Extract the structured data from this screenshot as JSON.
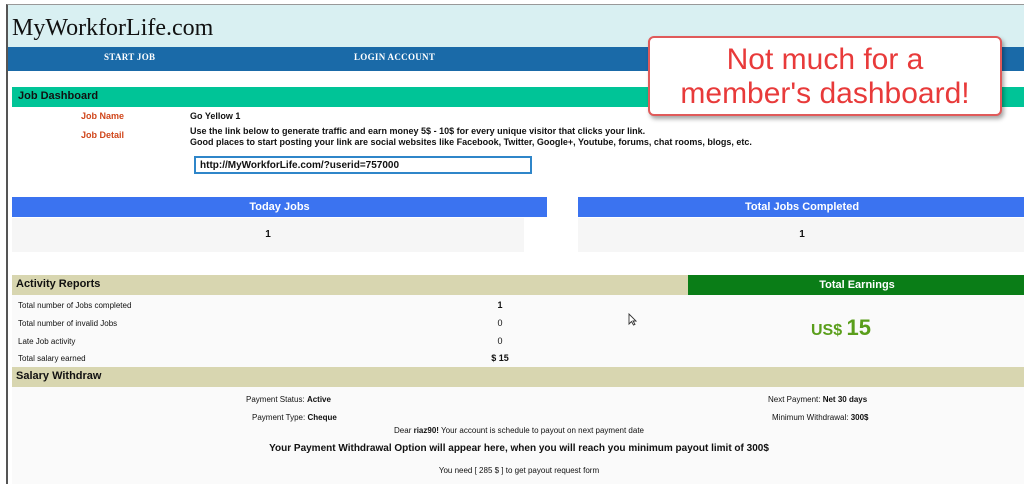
{
  "site": {
    "title": "MyWorkforLife.com"
  },
  "nav": {
    "items": [
      {
        "label": "START JOB"
      },
      {
        "label": "LOGIN ACCOUNT"
      }
    ]
  },
  "dashboard": {
    "heading": "Job Dashboard",
    "job_name_label": "Job Name",
    "job_name_value": "Go Yellow 1",
    "job_detail_label": "Job Detail",
    "job_detail_line1": "Use the link below to generate traffic and earn money 5$ - 10$ for every unique visitor that clicks your link.",
    "job_detail_line2": "Good places to start posting your link are social websites like Facebook, Twitter, Google+, Youtube, forums, chat rooms, blogs, etc.",
    "referral_link": "http://MyWorkforLife.com/?userid=757000"
  },
  "stats": {
    "today_jobs_label": "Today Jobs",
    "today_jobs_value": "1",
    "total_completed_label": "Total Jobs Completed",
    "total_completed_value": "1"
  },
  "activity": {
    "heading": "Activity Reports",
    "rows": [
      {
        "label": "Total number of Jobs completed",
        "value": "1"
      },
      {
        "label": "Total number of invalid Jobs",
        "value": "0"
      },
      {
        "label": "Late Job activity",
        "value": "0"
      },
      {
        "label": "Total salary earned",
        "value": "$ 15"
      }
    ]
  },
  "earnings": {
    "heading": "Total Earnings",
    "currency": "US$",
    "amount": "15"
  },
  "salary": {
    "heading": "Salary Withdraw",
    "payment_status_label": "Payment Status:",
    "payment_status_value": "Active",
    "payment_type_label": "Payment Type:",
    "payment_type_value": "Cheque",
    "next_payment_label": "Next Payment:",
    "next_payment_value": "Net 30 days",
    "min_withdrawal_label": "Minimum Withdrawal:",
    "min_withdrawal_value": "300$",
    "dear_prefix": "Dear",
    "username": "riaz90!",
    "dear_suffix": "Your account is schedule to payout on next payment date",
    "option_notice": "Your Payment Withdrawal Option will appear here, when you will reach you minimum payout limit of 300$",
    "need_notice": "You need [ 285 $ ] to get payout request form"
  },
  "callout": {
    "line1": "Not much for a",
    "line2": "member's dashboard!"
  },
  "colors": {
    "header_bg": "#d9f0f2",
    "nav_bg": "#1a6aa8",
    "dashboard_head": "#00c497",
    "stat_head": "#3b73f0",
    "section_head": "#d8d6b0",
    "earnings_head": "#0a7d17",
    "earnings_text": "#5a9e1b",
    "label_orange": "#d0461b",
    "callout_red": "#e83a3a"
  },
  "icons": {
    "cursor": "mouse-pointer-icon"
  }
}
